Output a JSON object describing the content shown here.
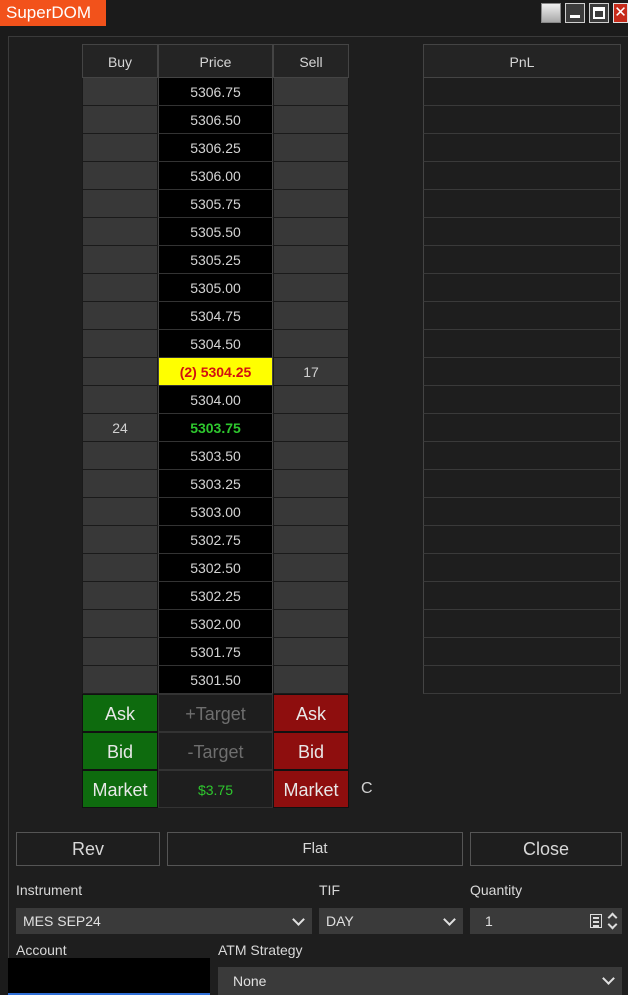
{
  "window": {
    "title": "SuperDOM",
    "close_glyph": "✕"
  },
  "ladder": {
    "headers": {
      "buy": "Buy",
      "price": "Price",
      "sell": "Sell"
    },
    "rows": [
      {
        "price": "5306.75",
        "buy": "",
        "sell": "",
        "style": ""
      },
      {
        "price": "5306.50",
        "buy": "",
        "sell": "",
        "style": ""
      },
      {
        "price": "5306.25",
        "buy": "",
        "sell": "",
        "style": ""
      },
      {
        "price": "5306.00",
        "buy": "",
        "sell": "",
        "style": ""
      },
      {
        "price": "5305.75",
        "buy": "",
        "sell": "",
        "style": ""
      },
      {
        "price": "5305.50",
        "buy": "",
        "sell": "",
        "style": ""
      },
      {
        "price": "5305.25",
        "buy": "",
        "sell": "",
        "style": ""
      },
      {
        "price": "5305.00",
        "buy": "",
        "sell": "",
        "style": ""
      },
      {
        "price": "5304.75",
        "buy": "",
        "sell": "",
        "style": ""
      },
      {
        "price": "5304.50",
        "buy": "",
        "sell": "",
        "style": ""
      },
      {
        "price": "(2) 5304.25",
        "buy": "",
        "sell": "17",
        "style": "highlight"
      },
      {
        "price": "5304.00",
        "buy": "",
        "sell": "",
        "style": ""
      },
      {
        "price": "5303.75",
        "buy": "24",
        "sell": "",
        "style": "last"
      },
      {
        "price": "5303.50",
        "buy": "",
        "sell": "",
        "style": ""
      },
      {
        "price": "5303.25",
        "buy": "",
        "sell": "",
        "style": ""
      },
      {
        "price": "5303.00",
        "buy": "",
        "sell": "",
        "style": ""
      },
      {
        "price": "5302.75",
        "buy": "",
        "sell": "",
        "style": ""
      },
      {
        "price": "5302.50",
        "buy": "",
        "sell": "",
        "style": ""
      },
      {
        "price": "5302.25",
        "buy": "",
        "sell": "",
        "style": ""
      },
      {
        "price": "5302.00",
        "buy": "",
        "sell": "",
        "style": ""
      },
      {
        "price": "5301.75",
        "buy": "",
        "sell": "",
        "style": ""
      },
      {
        "price": "5301.50",
        "buy": "",
        "sell": "",
        "style": ""
      }
    ],
    "actions": [
      {
        "buy": "Ask",
        "mid": "+Target",
        "sell": "Ask",
        "mid_style": ""
      },
      {
        "buy": "Bid",
        "mid": "-Target",
        "sell": "Bid",
        "mid_style": ""
      },
      {
        "buy": "Market",
        "mid": "$3.75",
        "sell": "Market",
        "mid_style": "pnl"
      }
    ],
    "cancel_label": "C"
  },
  "pnl": {
    "header": "PnL",
    "row_count": 22
  },
  "buttons": {
    "rev": "Rev",
    "flat": "Flat",
    "close": "Close"
  },
  "form": {
    "instrument_label": "Instrument",
    "instrument_value": "MES SEP24",
    "tif_label": "TIF",
    "tif_value": "DAY",
    "quantity_label": "Quantity",
    "quantity_value": "1",
    "account_label": "Account",
    "account_value": "",
    "atm_label": "ATM Strategy",
    "atm_value": "None"
  },
  "colors": {
    "title_accent": "#f2521b",
    "buy_green": "#0e6b0e",
    "sell_red": "#8e0e0e",
    "highlight_yellow": "#ffff00",
    "last_price_green": "#2ec72e"
  }
}
